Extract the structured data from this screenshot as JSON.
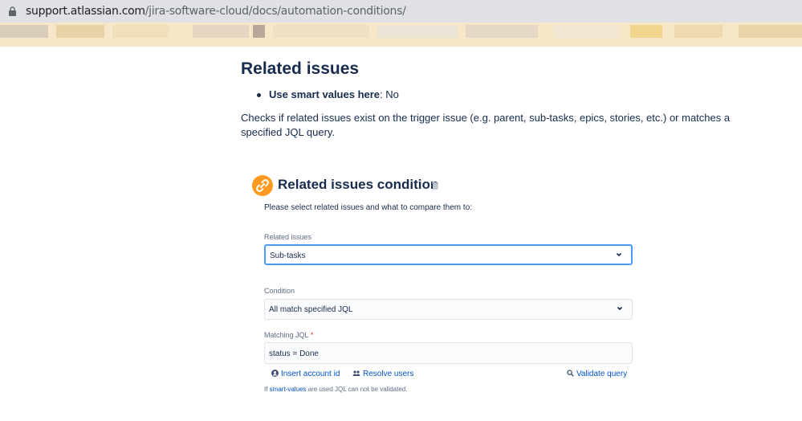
{
  "browser": {
    "url_domain": "support.atlassian.com",
    "url_path": "/jira-software-cloud/docs/automation-conditions/"
  },
  "article": {
    "heading": "Related issues",
    "bullet_bold": "Use smart values here",
    "bullet_rest": ": No",
    "paragraph": "Checks if related issues exist on the trigger issue (e.g. parent, sub-tasks, epics, stories, etc.) or matches a specified JQL query."
  },
  "condition_panel": {
    "title": "Related issues condition",
    "subtitle": "Please select related issues and what to compare them to:",
    "related_issues_label": "Related issues",
    "related_issues_value": "Sub-tasks",
    "condition_label": "Condition",
    "condition_value": "All match specified JQL",
    "jql_label": "Matching JQL",
    "jql_required_mark": "*",
    "jql_value": "status = Done",
    "insert_account_id": "Insert account id",
    "resolve_users": "Resolve users",
    "validate_query": "Validate query",
    "footnote_pre": "If ",
    "footnote_kw": "smart-values",
    "footnote_post": " are used JQL can not be validated."
  },
  "colors": {
    "accent": "#ff991f",
    "link": "#0052cc",
    "focus_border": "#4c9aff",
    "text": "#172b4d"
  },
  "icons": [
    "lock-icon",
    "link-chain-icon",
    "trash-icon",
    "chevron-down-icon",
    "user-circle-icon",
    "users-icon",
    "search-icon"
  ]
}
